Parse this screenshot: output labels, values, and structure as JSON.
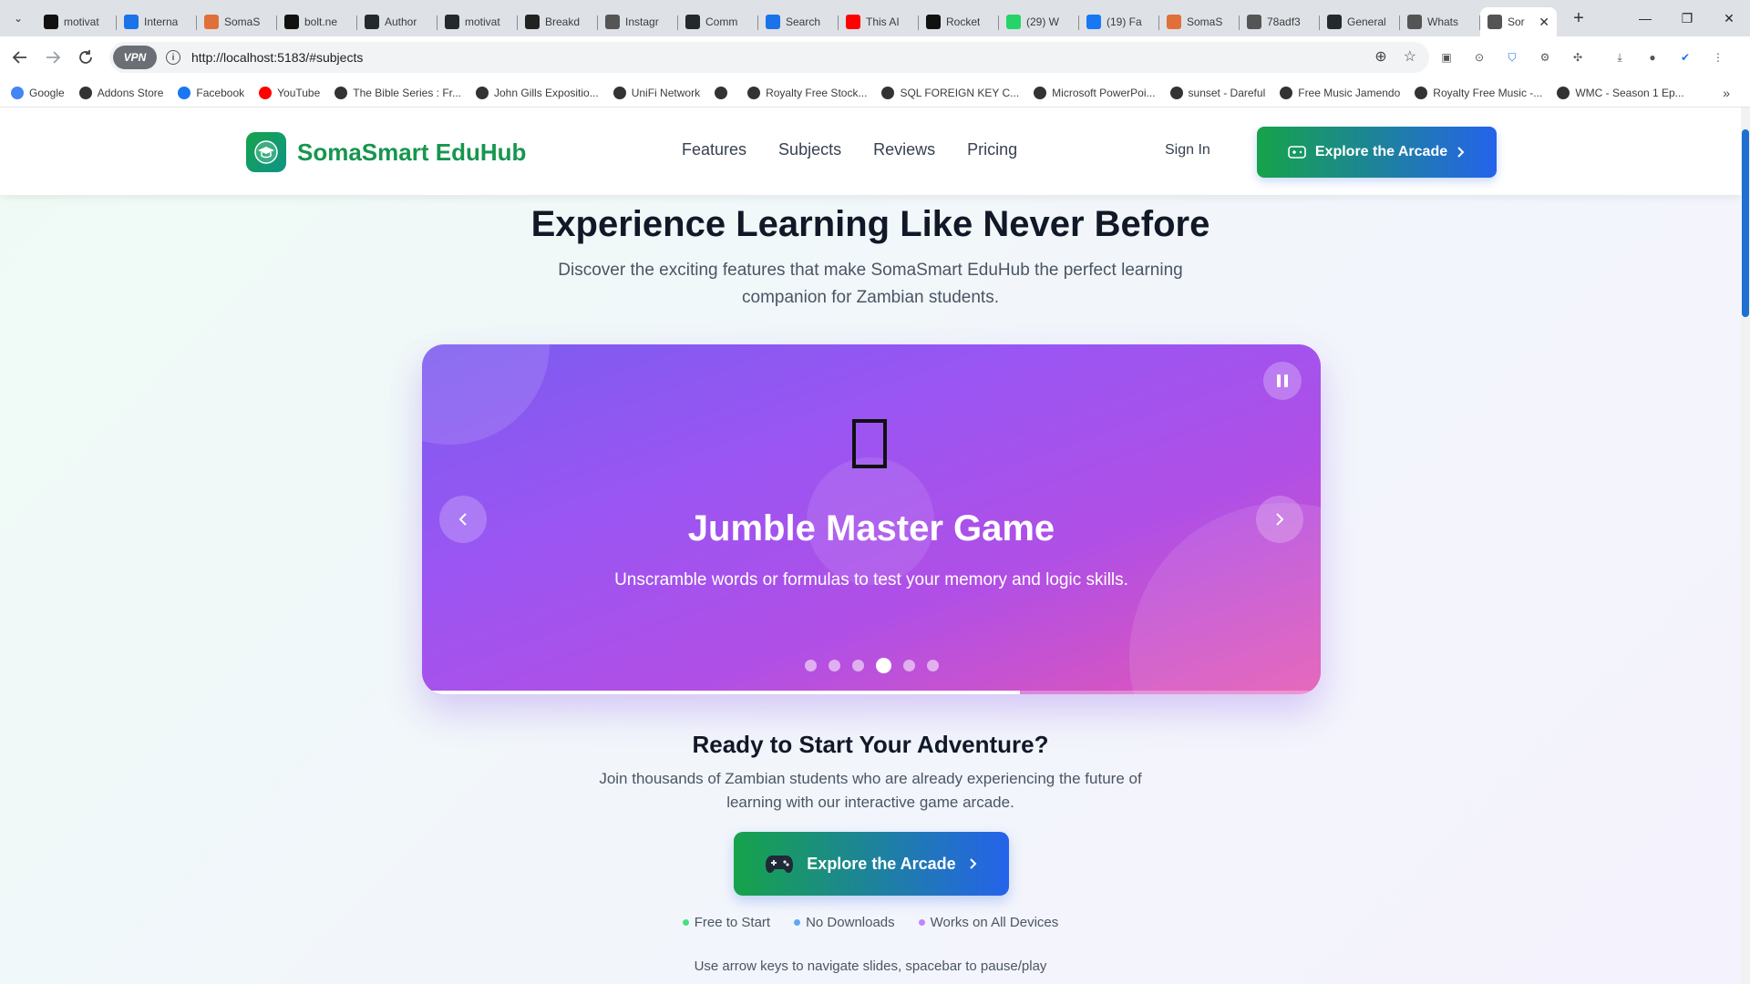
{
  "browser": {
    "tabs": [
      {
        "title": "motivat",
        "icon": "activity-icon",
        "color": "#111111"
      },
      {
        "title": "Interna",
        "icon": "butterfly-icon",
        "color": "#1a73e8"
      },
      {
        "title": "SomaS",
        "icon": "sparkle-icon",
        "color": "#e0703a"
      },
      {
        "title": "bolt.ne",
        "icon": "bolt-icon",
        "color": "#111111"
      },
      {
        "title": "Author",
        "icon": "github-icon",
        "color": "#24292e"
      },
      {
        "title": "motivat",
        "icon": "github-icon",
        "color": "#24292e"
      },
      {
        "title": "Breakd",
        "icon": "target-icon",
        "color": "#222222"
      },
      {
        "title": "Instagr",
        "icon": "globe-icon",
        "color": "#555555"
      },
      {
        "title": "Comm",
        "icon": "github-icon",
        "color": "#24292e"
      },
      {
        "title": "Search",
        "icon": "search-brand-icon",
        "color": "#1a73e8"
      },
      {
        "title": "This AI",
        "icon": "youtube-icon",
        "color": "#ff0000"
      },
      {
        "title": "Rocket",
        "icon": "rocket-icon",
        "color": "#111111"
      },
      {
        "title": "(29) W",
        "icon": "whatsapp-icon",
        "color": "#25d366"
      },
      {
        "title": "(19) Fa",
        "icon": "facebook-icon",
        "color": "#1877f2"
      },
      {
        "title": "SomaS",
        "icon": "sparkle-icon",
        "color": "#e0703a"
      },
      {
        "title": "78adf3",
        "icon": "globe-icon",
        "color": "#555555"
      },
      {
        "title": "General",
        "icon": "github-icon",
        "color": "#24292e"
      },
      {
        "title": "Whats",
        "icon": "globe-icon",
        "color": "#555555"
      }
    ],
    "active_tab": {
      "title": "Sor",
      "icon": "globe-icon",
      "color": "#555555"
    },
    "url": "http://localhost:5183/#subjects",
    "vpn_label": "VPN",
    "bookmarks": [
      {
        "label": "Google",
        "color": "#4285f4"
      },
      {
        "label": "Addons Store",
        "color": "#333333"
      },
      {
        "label": "Facebook",
        "color": "#1877f2"
      },
      {
        "label": "YouTube",
        "color": "#ff0000"
      },
      {
        "label": "The Bible Series : Fr...",
        "color": "#333333"
      },
      {
        "label": "John Gills Expositio...",
        "color": "#333333"
      },
      {
        "label": "UniFi Network",
        "color": "#333333"
      },
      {
        "label": "",
        "color": "#333333"
      },
      {
        "label": "Royalty Free Stock...",
        "color": "#333333"
      },
      {
        "label": "SQL FOREIGN KEY C...",
        "color": "#333333"
      },
      {
        "label": "Microsoft PowerPoi...",
        "color": "#333333"
      },
      {
        "label": "sunset - Dareful",
        "color": "#333333"
      },
      {
        "label": "Free Music Jamendo",
        "color": "#333333"
      },
      {
        "label": "Royalty Free Music -...",
        "color": "#333333"
      },
      {
        "label": "WMC - Season 1 Ep...",
        "color": "#333333"
      }
    ]
  },
  "site": {
    "brand": "SomaSmart EduHub",
    "nav": [
      "Features",
      "Subjects",
      "Reviews",
      "Pricing"
    ],
    "sign_in": "Sign In",
    "explore_button": "Explore the Arcade"
  },
  "section": {
    "heading": "Experience Learning Like Never Before",
    "subheading": "Discover the exciting features that make SomaSmart EduHub the perfect learning companion for Zambian students."
  },
  "carousel": {
    "slide_title": "Jumble Master Game",
    "slide_description": "Unscramble words or formulas to test your memory and logic skills.",
    "slide_count": 6,
    "active_index": 3,
    "progress": 0.665
  },
  "cta": {
    "title": "Ready to Start Your Adventure?",
    "text": "Join thousands of Zambian students who are already experiencing the future of learning with our interactive game arcade.",
    "button": "Explore the Arcade",
    "features": [
      {
        "label": "Free to Start",
        "color": "#4ade80"
      },
      {
        "label": "No Downloads",
        "color": "#60a5fa"
      },
      {
        "label": "Works on All Devices",
        "color": "#c084fc"
      }
    ],
    "hint": "Use arrow keys to navigate slides, spacebar to pause/play"
  }
}
